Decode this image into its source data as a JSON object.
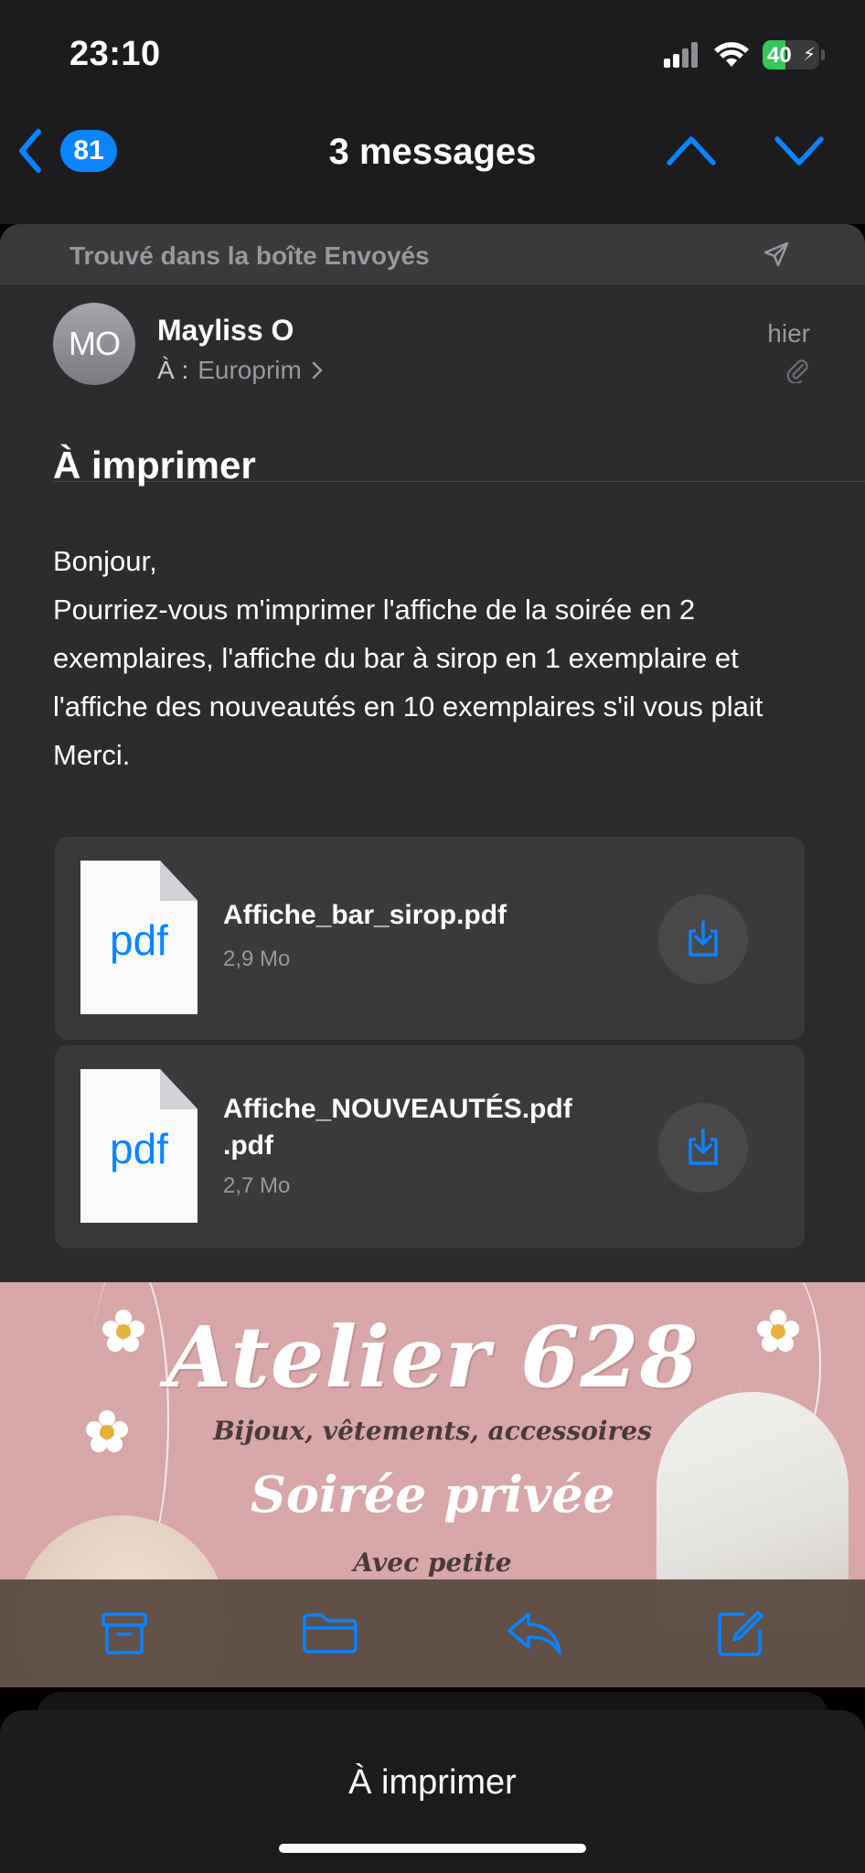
{
  "status_bar": {
    "time": "23:10",
    "battery_level": "40",
    "icons": [
      "signal-icon",
      "wifi-icon",
      "battery-icon",
      "charging-bolt-icon"
    ]
  },
  "nav": {
    "back_count": "81",
    "title": "3 messages",
    "icons": [
      "back-chevron-icon",
      "previous-message-icon",
      "next-message-icon"
    ]
  },
  "banner": {
    "text": "Trouvé dans la boîte Envoyés",
    "icon": "sent-icon"
  },
  "message": {
    "avatar_initials": "MO",
    "sender": "Mayliss O",
    "to_label": "À :",
    "recipient": "Europrim",
    "date": "hier",
    "subject": "À imprimer",
    "body": "Bonjour,\nPourriez-vous m'imprimer l'affiche de la soirée en 2 exemplaires, l'affiche du bar à sirop en 1 exemplaire et l'affiche des nouveautés en 10 exemplaires s'il vous plait\nMerci."
  },
  "attachments": [
    {
      "name": "Affiche_bar_sirop.pdf",
      "size": "2,9 Mo",
      "type_label": "pdf"
    },
    {
      "name": "Affiche_NOUVEAUTÉS.pdf .pdf",
      "size": "2,7 Mo",
      "type_label": "pdf"
    }
  ],
  "poster": {
    "title": "Atelier 628",
    "subtitle": "Bijoux, vêtements, accessoires",
    "event": "Soirée privée",
    "more": "Avec petite"
  },
  "toolbar": {
    "items": [
      "archive-icon",
      "folder-icon",
      "reply-icon",
      "compose-icon"
    ]
  },
  "bottom_sheet": {
    "title": "À imprimer"
  },
  "colors": {
    "accent": "#0a84ff",
    "battery": "#34c759",
    "poster_pink": "#d8a7aa"
  }
}
